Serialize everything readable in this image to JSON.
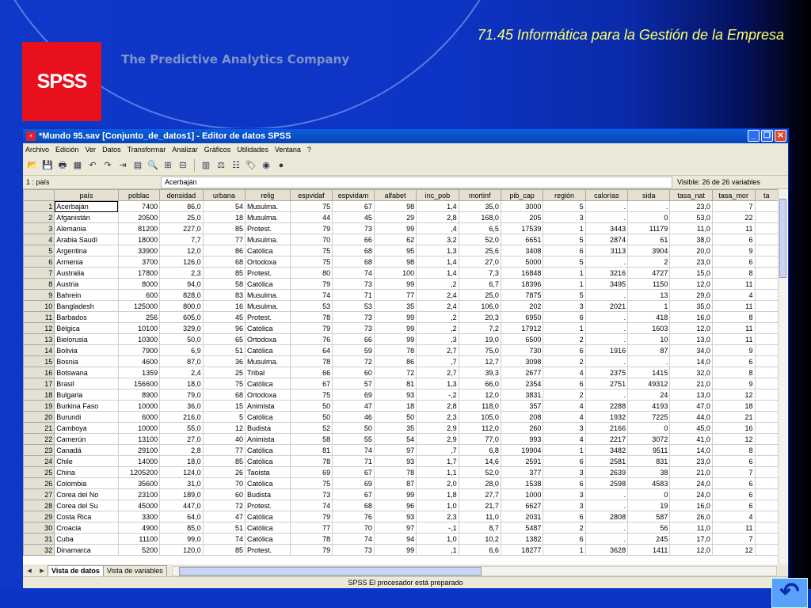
{
  "slide": {
    "title": "71.45 Informática para la Gestión de la Empresa",
    "logo": "SPSS",
    "tagline": "The Predictive Analytics Company"
  },
  "window": {
    "title": "*Mundo 95.sav [Conjunto_de_datos1] - Editor de datos SPSS",
    "menu": [
      "Archivo",
      "Edición",
      "Ver",
      "Datos",
      "Transformar",
      "Analizar",
      "Gráficos",
      "Utilidades",
      "Ventana",
      "?"
    ],
    "toolbar_icons": [
      "open-icon",
      "save-icon",
      "print-icon",
      "dialog-recall-icon",
      "undo-icon",
      "redo-icon",
      "goto-case-icon",
      "variables-icon",
      "find-icon",
      "insert-cases-icon",
      "insert-variable-icon",
      "split-file-icon",
      "weight-cases-icon",
      "select-cases-icon",
      "value-labels-icon",
      "use-sets-icon",
      "show-all-icon"
    ],
    "cell_ref": "1 : país",
    "cell_value": "Acerbaján",
    "visible": "Visible: 26 de 26 variables",
    "tabs": [
      "Vista de datos",
      "Vista de variables"
    ],
    "status": "SPSS El procesador  está preparado"
  },
  "grid": {
    "columns": [
      "país",
      "poblac",
      "densidad",
      "urbana",
      "relig",
      "espvidaf",
      "espvidam",
      "alfabet",
      "inc_pob",
      "mortinf",
      "pib_cap",
      "región",
      "calorías",
      "sida",
      "tasa_nat",
      "tasa_mor",
      "ta"
    ],
    "rows": [
      [
        "1",
        "Acerbaján",
        "7400",
        "86,0",
        "54",
        "Musulma.",
        "75",
        "67",
        "98",
        "1,4",
        "35,0",
        "3000",
        "5",
        ".",
        ".",
        "23,0",
        "7"
      ],
      [
        "2",
        "Afganistán",
        "20500",
        "25,0",
        "18",
        "Musulma.",
        "44",
        "45",
        "29",
        "2,8",
        "168,0",
        "205",
        "3",
        ".",
        "0",
        "53,0",
        "22"
      ],
      [
        "3",
        "Alemania",
        "81200",
        "227,0",
        "85",
        "Protest.",
        "79",
        "73",
        "99",
        ",4",
        "6,5",
        "17539",
        "1",
        "3443",
        "11179",
        "11,0",
        "11"
      ],
      [
        "4",
        "Arabia Saudí",
        "18000",
        "7,7",
        "77",
        "Musulma.",
        "70",
        "66",
        "62",
        "3,2",
        "52,0",
        "6651",
        "5",
        "2874",
        "61",
        "38,0",
        "6"
      ],
      [
        "5",
        "Argentina",
        "33900",
        "12,0",
        "86",
        "Católica",
        "75",
        "68",
        "95",
        "1,3",
        "25,6",
        "3408",
        "6",
        "3113",
        "3904",
        "20,0",
        "9"
      ],
      [
        "6",
        "Armenia",
        "3700",
        "126,0",
        "68",
        "Ortodoxa",
        "75",
        "68",
        "98",
        "1,4",
        "27,0",
        "5000",
        "5",
        ".",
        "2",
        "23,0",
        "6"
      ],
      [
        "7",
        "Australia",
        "17800",
        "2,3",
        "85",
        "Protest.",
        "80",
        "74",
        "100",
        "1,4",
        "7,3",
        "16848",
        "1",
        "3216",
        "4727",
        "15,0",
        "8"
      ],
      [
        "8",
        "Austria",
        "8000",
        "94,0",
        "58",
        "Católica",
        "79",
        "73",
        "99",
        ",2",
        "6,7",
        "18396",
        "1",
        "3495",
        "1150",
        "12,0",
        "11"
      ],
      [
        "9",
        "Bahrein",
        "600",
        "828,0",
        "83",
        "Musulma.",
        "74",
        "71",
        "77",
        "2,4",
        "25,0",
        "7875",
        "5",
        ".",
        "13",
        "29,0",
        "4"
      ],
      [
        "10",
        "Bangladesh",
        "125000",
        "800,0",
        "16",
        "Musulma.",
        "53",
        "53",
        "35",
        "2,4",
        "106,0",
        "202",
        "3",
        "2021",
        "1",
        "35,0",
        "11"
      ],
      [
        "11",
        "Barbados",
        "256",
        "605,0",
        "45",
        "Protest.",
        "78",
        "73",
        "99",
        ",2",
        "20,3",
        "6950",
        "6",
        ".",
        "418",
        "16,0",
        "8"
      ],
      [
        "12",
        "Bélgica",
        "10100",
        "329,0",
        "96",
        "Católica",
        "79",
        "73",
        "99",
        ",2",
        "7,2",
        "17912",
        "1",
        ".",
        "1603",
        "12,0",
        "11"
      ],
      [
        "13",
        "Bielorusia",
        "10300",
        "50,0",
        "65",
        "Ortodoxa",
        "76",
        "66",
        "99",
        ",3",
        "19,0",
        "6500",
        "2",
        ".",
        "10",
        "13,0",
        "11"
      ],
      [
        "14",
        "Bolivia",
        "7900",
        "6,9",
        "51",
        "Católica",
        "64",
        "59",
        "78",
        "2,7",
        "75,0",
        "730",
        "6",
        "1916",
        "87",
        "34,0",
        "9"
      ],
      [
        "15",
        "Bosnia",
        "4600",
        "87,0",
        "36",
        "Musulma.",
        "78",
        "72",
        "86",
        ",7",
        "12,7",
        "3098",
        "2",
        ".",
        ".",
        "14,0",
        "6"
      ],
      [
        "16",
        "Botswana",
        "1359",
        "2,4",
        "25",
        "Tribal",
        "66",
        "60",
        "72",
        "2,7",
        "39,3",
        "2677",
        "4",
        "2375",
        "1415",
        "32,0",
        "8"
      ],
      [
        "17",
        "Brasil",
        "156600",
        "18,0",
        "75",
        "Católica",
        "67",
        "57",
        "81",
        "1,3",
        "66,0",
        "2354",
        "6",
        "2751",
        "49312",
        "21,0",
        "9"
      ],
      [
        "18",
        "Bulgaria",
        "8900",
        "79,0",
        "68",
        "Ortodoxa",
        "75",
        "69",
        "93",
        "-,2",
        "12,0",
        "3831",
        "2",
        ".",
        "24",
        "13,0",
        "12"
      ],
      [
        "19",
        "Burkina Faso",
        "10000",
        "36,0",
        "15",
        "Animista",
        "50",
        "47",
        "18",
        "2,8",
        "118,0",
        "357",
        "4",
        "2288",
        "4193",
        "47,0",
        "18"
      ],
      [
        "20",
        "Burundi",
        "6000",
        "216,0",
        "5",
        "Católica",
        "50",
        "46",
        "50",
        "2,3",
        "105,0",
        "208",
        "4",
        "1932",
        "7225",
        "44,0",
        "21"
      ],
      [
        "21",
        "Camboya",
        "10000",
        "55,0",
        "12",
        "Budista",
        "52",
        "50",
        "35",
        "2,9",
        "112,0",
        "260",
        "3",
        "2166",
        "0",
        "45,0",
        "16"
      ],
      [
        "22",
        "Camerún",
        "13100",
        "27,0",
        "40",
        "Animista",
        "58",
        "55",
        "54",
        "2,9",
        "77,0",
        "993",
        "4",
        "2217",
        "3072",
        "41,0",
        "12"
      ],
      [
        "23",
        "Canadá",
        "29100",
        "2,8",
        "77",
        "Católica",
        "81",
        "74",
        "97",
        ",7",
        "6,8",
        "19904",
        "1",
        "3482",
        "9511",
        "14,0",
        "8"
      ],
      [
        "24",
        "Chile",
        "14000",
        "18,0",
        "85",
        "Católica",
        "78",
        "71",
        "93",
        "1,7",
        "14,6",
        "2591",
        "6",
        "2581",
        "831",
        "23,0",
        "6"
      ],
      [
        "25",
        "China",
        "1205200",
        "124,0",
        "26",
        "Taoista",
        "69",
        "67",
        "78",
        "1,1",
        "52,0",
        "377",
        "3",
        "2639",
        "38",
        "21,0",
        "7"
      ],
      [
        "26",
        "Colombia",
        "35600",
        "31,0",
        "70",
        "Católica",
        "75",
        "69",
        "87",
        "2,0",
        "28,0",
        "1538",
        "6",
        "2598",
        "4583",
        "24,0",
        "6"
      ],
      [
        "27",
        "Corea del No",
        "23100",
        "189,0",
        "60",
        "Budista",
        "73",
        "67",
        "99",
        "1,8",
        "27,7",
        "1000",
        "3",
        ".",
        "0",
        "24,0",
        "6"
      ],
      [
        "28",
        "Corea del Su",
        "45000",
        "447,0",
        "72",
        "Protest.",
        "74",
        "68",
        "96",
        "1,0",
        "21,7",
        "6627",
        "3",
        ".",
        "19",
        "16,0",
        "6"
      ],
      [
        "29",
        "Costa Rica",
        "3300",
        "64,0",
        "47",
        "Católica",
        "79",
        "76",
        "93",
        "2,3",
        "11,0",
        "2031",
        "6",
        "2808",
        "587",
        "26,0",
        "4"
      ],
      [
        "30",
        "Croacia",
        "4900",
        "85,0",
        "51",
        "Católica",
        "77",
        "70",
        "97",
        "-,1",
        "8,7",
        "5487",
        "2",
        ".",
        "56",
        "11,0",
        "11"
      ],
      [
        "31",
        "Cuba",
        "11100",
        "99,0",
        "74",
        "Católica",
        "78",
        "74",
        "94",
        "1,0",
        "10,2",
        "1382",
        "6",
        ".",
        "245",
        "17,0",
        "7"
      ],
      [
        "32",
        "Dinamarca",
        "5200",
        "120,0",
        "85",
        "Protest.",
        "79",
        "73",
        "99",
        ",1",
        "6,6",
        "18277",
        "1",
        "3628",
        "1411",
        "12,0",
        "12"
      ]
    ]
  }
}
